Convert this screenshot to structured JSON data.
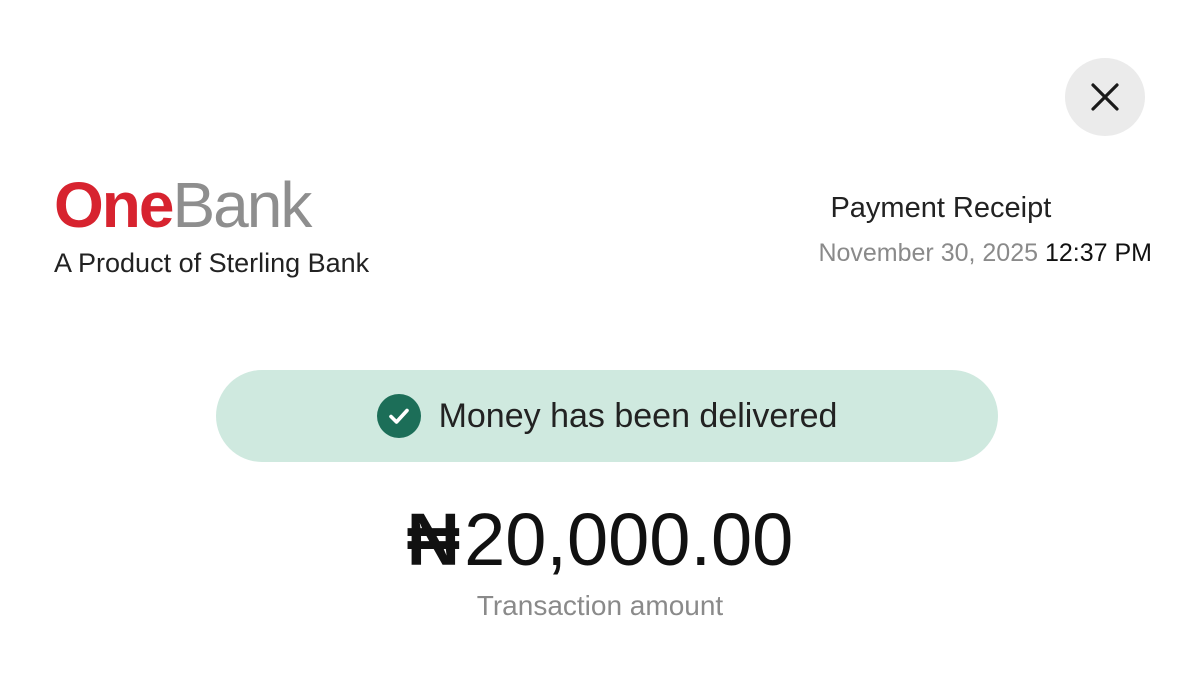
{
  "header": {
    "close_icon": "close-icon"
  },
  "brand": {
    "logo_part_one": "One",
    "logo_part_two": "Bank",
    "tagline": "A Product of Sterling Bank"
  },
  "receipt": {
    "title": "Payment Receipt",
    "date": "November 30, 2025",
    "time": "12:37 PM"
  },
  "status": {
    "icon": "check-circle-icon",
    "text": "Money has been delivered"
  },
  "transaction": {
    "currency_symbol": "₦",
    "amount": "20,000.00",
    "label": "Transaction amount"
  },
  "colors": {
    "brand_red": "#d7232f",
    "brand_gray": "#8e8e8e",
    "success_bg": "#cfe9df",
    "success_icon": "#1c6e58"
  }
}
